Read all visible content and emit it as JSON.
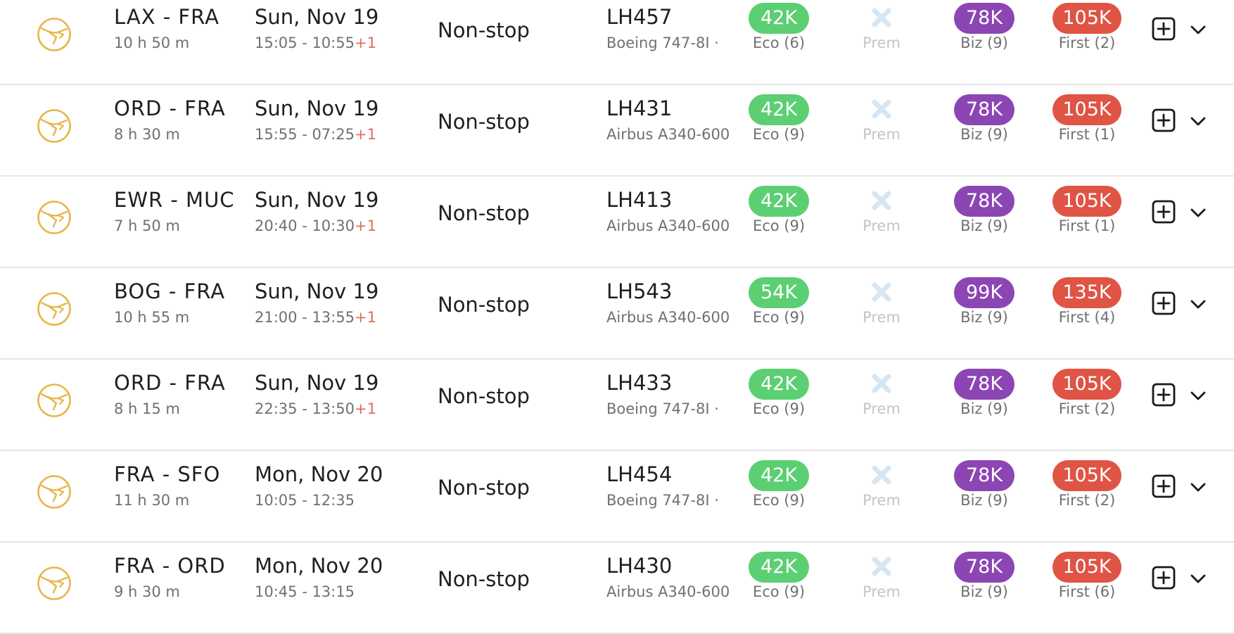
{
  "colors": {
    "eco": "#5ccf73",
    "biz": "#8c46b3",
    "first": "#df5445",
    "airline_logo": "#e8b64a",
    "prem_unavailable": "#d6e6f2"
  },
  "icons": {
    "airline_logo": "lufthansa-crane-logo-icon",
    "prem_unavailable": "x-mark-icon",
    "add": "plus-square-icon",
    "expand": "chevron-down-icon"
  },
  "flights": [
    {
      "route": "LAX - FRA",
      "duration": "10 h 50 m",
      "date": "Sun, Nov 19",
      "times": "15:05 - 10:55",
      "day_offset": "+1",
      "stops": "Non-stop",
      "flight_no": "LH457",
      "aircraft": "Boeing 747-8I  ·",
      "eco": {
        "price": "42K",
        "label": "Eco (6)"
      },
      "prem": {
        "label": "Prem"
      },
      "biz": {
        "price": "78K",
        "label": "Biz (9)"
      },
      "first": {
        "price": "105K",
        "label": "First (2)"
      }
    },
    {
      "route": "ORD - FRA",
      "duration": "8 h 30 m",
      "date": "Sun, Nov 19",
      "times": "15:55 - 07:25",
      "day_offset": "+1",
      "stops": "Non-stop",
      "flight_no": "LH431",
      "aircraft": "Airbus A340-600",
      "eco": {
        "price": "42K",
        "label": "Eco (9)"
      },
      "prem": {
        "label": "Prem"
      },
      "biz": {
        "price": "78K",
        "label": "Biz (9)"
      },
      "first": {
        "price": "105K",
        "label": "First (1)"
      }
    },
    {
      "route": "EWR - MUC",
      "duration": "7 h 50 m",
      "date": "Sun, Nov 19",
      "times": "20:40 - 10:30",
      "day_offset": "+1",
      "stops": "Non-stop",
      "flight_no": "LH413",
      "aircraft": "Airbus A340-600",
      "eco": {
        "price": "42K",
        "label": "Eco (9)"
      },
      "prem": {
        "label": "Prem"
      },
      "biz": {
        "price": "78K",
        "label": "Biz (9)"
      },
      "first": {
        "price": "105K",
        "label": "First (1)"
      }
    },
    {
      "route": "BOG - FRA",
      "duration": "10 h 55 m",
      "date": "Sun, Nov 19",
      "times": "21:00 - 13:55",
      "day_offset": "+1",
      "stops": "Non-stop",
      "flight_no": "LH543",
      "aircraft": "Airbus A340-600",
      "eco": {
        "price": "54K",
        "label": "Eco (9)"
      },
      "prem": {
        "label": "Prem"
      },
      "biz": {
        "price": "99K",
        "label": "Biz (9)"
      },
      "first": {
        "price": "135K",
        "label": "First (4)"
      }
    },
    {
      "route": "ORD - FRA",
      "duration": "8 h 15 m",
      "date": "Sun, Nov 19",
      "times": "22:35 - 13:50",
      "day_offset": "+1",
      "stops": "Non-stop",
      "flight_no": "LH433",
      "aircraft": "Boeing 747-8I  ·",
      "eco": {
        "price": "42K",
        "label": "Eco (9)"
      },
      "prem": {
        "label": "Prem"
      },
      "biz": {
        "price": "78K",
        "label": "Biz (9)"
      },
      "first": {
        "price": "105K",
        "label": "First (2)"
      }
    },
    {
      "route": "FRA - SFO",
      "duration": "11 h 30 m",
      "date": "Mon, Nov 20",
      "times": "10:05 - 12:35",
      "day_offset": "",
      "stops": "Non-stop",
      "flight_no": "LH454",
      "aircraft": "Boeing 747-8I  ·",
      "eco": {
        "price": "42K",
        "label": "Eco (9)"
      },
      "prem": {
        "label": "Prem"
      },
      "biz": {
        "price": "78K",
        "label": "Biz (9)"
      },
      "first": {
        "price": "105K",
        "label": "First (2)"
      }
    },
    {
      "route": "FRA - ORD",
      "duration": "9 h 30 m",
      "date": "Mon, Nov 20",
      "times": "10:45 - 13:15",
      "day_offset": "",
      "stops": "Non-stop",
      "flight_no": "LH430",
      "aircraft": "Airbus A340-600",
      "eco": {
        "price": "42K",
        "label": "Eco (9)"
      },
      "prem": {
        "label": "Prem"
      },
      "biz": {
        "price": "78K",
        "label": "Biz (9)"
      },
      "first": {
        "price": "105K",
        "label": "First (6)"
      }
    }
  ]
}
